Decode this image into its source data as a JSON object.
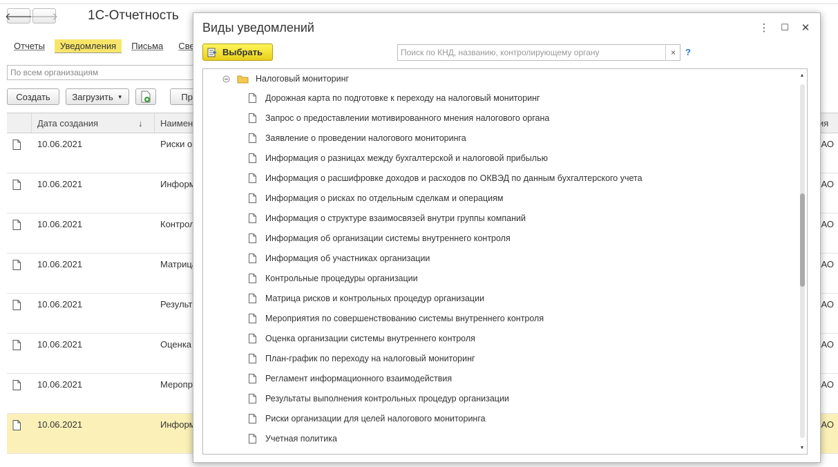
{
  "app": {
    "title": "1С-Отчетность",
    "back_icon": "arrow-left",
    "forward_icon": "arrow-right"
  },
  "tabs": [
    {
      "label": "Отчеты",
      "active": false
    },
    {
      "label": "Уведомления",
      "active": true
    },
    {
      "label": "Письма",
      "active": false
    },
    {
      "label": "Све",
      "active": false
    }
  ],
  "filter": {
    "organization_placeholder": "По всем организациям"
  },
  "toolbar": {
    "create_label": "Создать",
    "load_label": "Загрузить",
    "pr_label": "Пр"
  },
  "grid": {
    "columns": [
      "Дата создания",
      "Наимен",
      "ия"
    ],
    "sort_indicator": "↓",
    "rows": [
      {
        "date": "10.06.2021",
        "name": "Риски о",
        "org": "АО",
        "selected": false
      },
      {
        "date": "10.06.2021",
        "name": "Информ",
        "org": "АО",
        "selected": false
      },
      {
        "date": "10.06.2021",
        "name": "Контрол",
        "org": "АО",
        "selected": false
      },
      {
        "date": "10.06.2021",
        "name": "Матрица",
        "org": "АО",
        "selected": false
      },
      {
        "date": "10.06.2021",
        "name": "Результ",
        "org": "АО",
        "selected": false
      },
      {
        "date": "10.06.2021",
        "name": "Оценка",
        "org": "АО",
        "selected": false
      },
      {
        "date": "10.06.2021",
        "name": "Меропр",
        "org": "АО",
        "selected": false
      },
      {
        "date": "10.06.2021",
        "name": "Информ",
        "org": "АО",
        "selected": true
      }
    ]
  },
  "dialog": {
    "title": "Виды уведомлений",
    "select_label": "Выбрать",
    "search_placeholder": "Поиск по КНД, названию, контролирующему органу",
    "clear_label": "×",
    "help_label": "?",
    "menu_icon": "⋮",
    "maximize_icon": "☐",
    "close_icon": "✕",
    "tree": {
      "group_label": "Налоговый мониторинг",
      "items": [
        "Дорожная карта по подготовке к переходу на налоговый мониторинг",
        "Запрос о предоставлении мотивированного мнения налогового органа",
        "Заявление о проведении налогового мониторинга",
        "Информация о разницах между бухгалтерской и налоговой прибылью",
        "Информация о расшифровке доходов и расходов по ОКВЭД по данным бухгалтерского учета",
        "Информация о рисках по отдельным сделкам и операциям",
        "Информация о структуре взаимосвязей внутри группы компаний",
        "Информация об организации системы внутреннего контроля",
        "Информация об участниках организации",
        "Контрольные процедуры организации",
        "Матрица рисков и контрольных процедур организации",
        "Мероприятия по совершенствованию системы внутреннего контроля",
        "Оценка организации системы внутреннего контроля",
        "План-график по переходу на налоговый мониторинг",
        "Регламент информационного взаимодействия",
        "Результаты выполнения контрольных процедур организации",
        "Риски организации для целей налогового мониторинга",
        "Учетная политика"
      ]
    }
  },
  "colors": {
    "accent_yellow": "#f7e56a",
    "selected_row": "#fbf1b8",
    "help_blue": "#2277cc"
  }
}
